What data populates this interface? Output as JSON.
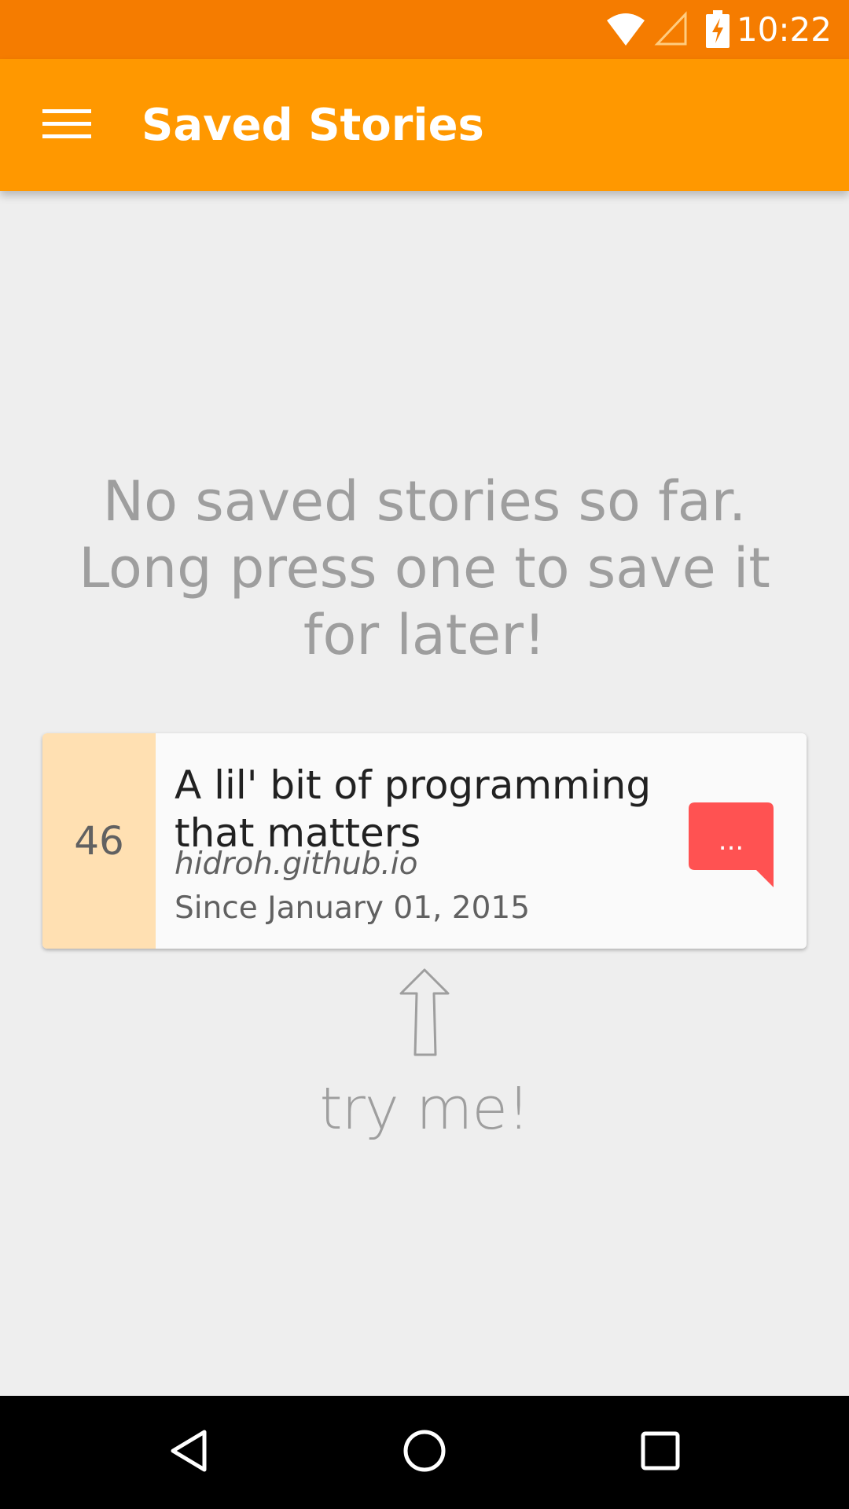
{
  "status_bar": {
    "time": "10:22",
    "icons": [
      "wifi-icon",
      "cell-signal-icon",
      "battery-charging-icon"
    ]
  },
  "app_bar": {
    "title": "Saved Stories",
    "menu_icon": "hamburger-menu-icon"
  },
  "empty_state": {
    "message": "No saved stories so far. Long press one to save it for later!"
  },
  "demo_story": {
    "score": "46",
    "title": "A lil' bit of programming that matters",
    "source": "hidroh.github.io",
    "since": "Since January 01, 2015",
    "comments_label": "...",
    "comments_icon": "comment-bubble-icon"
  },
  "hint": {
    "text": "try me!",
    "icon": "arrow-up-icon"
  },
  "navigation": {
    "icons": [
      "back-icon",
      "home-icon",
      "recents-icon"
    ]
  },
  "colors": {
    "status_bar": "#f57c00",
    "app_bar": "#ff9800",
    "background": "#eeeeee",
    "score_background": "#ffe0b2",
    "comments_accent": "#ff5252"
  }
}
